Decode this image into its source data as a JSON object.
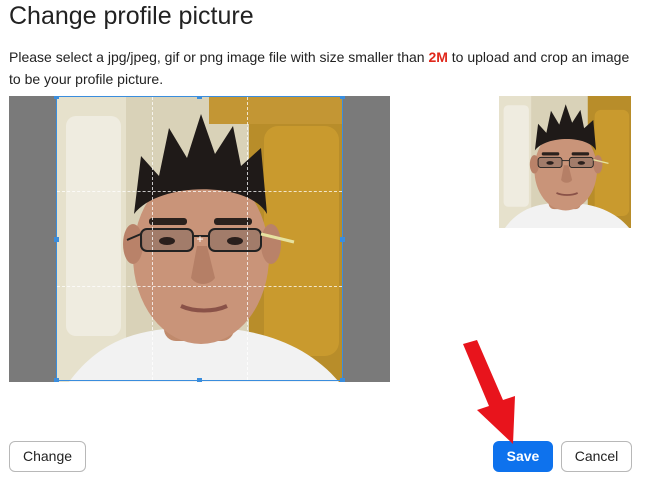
{
  "dialog": {
    "title": "Change profile picture",
    "description_before": "Please select a jpg/jpeg, gif or png image file with size smaller than ",
    "description_highlight": "2M",
    "description_after": " to upload and crop an image to be your profile picture.",
    "highlight_color": "#e0281b"
  },
  "buttons": {
    "change_label": "Change",
    "save_label": "Save",
    "cancel_label": "Cancel",
    "primary_color": "#0e72ed"
  },
  "crop": {
    "selection_color": "#3a8ddd",
    "center_marker": "+"
  },
  "annotation": {
    "arrow_icon": "red-arrow-icon",
    "arrow_color": "#e8141c"
  }
}
